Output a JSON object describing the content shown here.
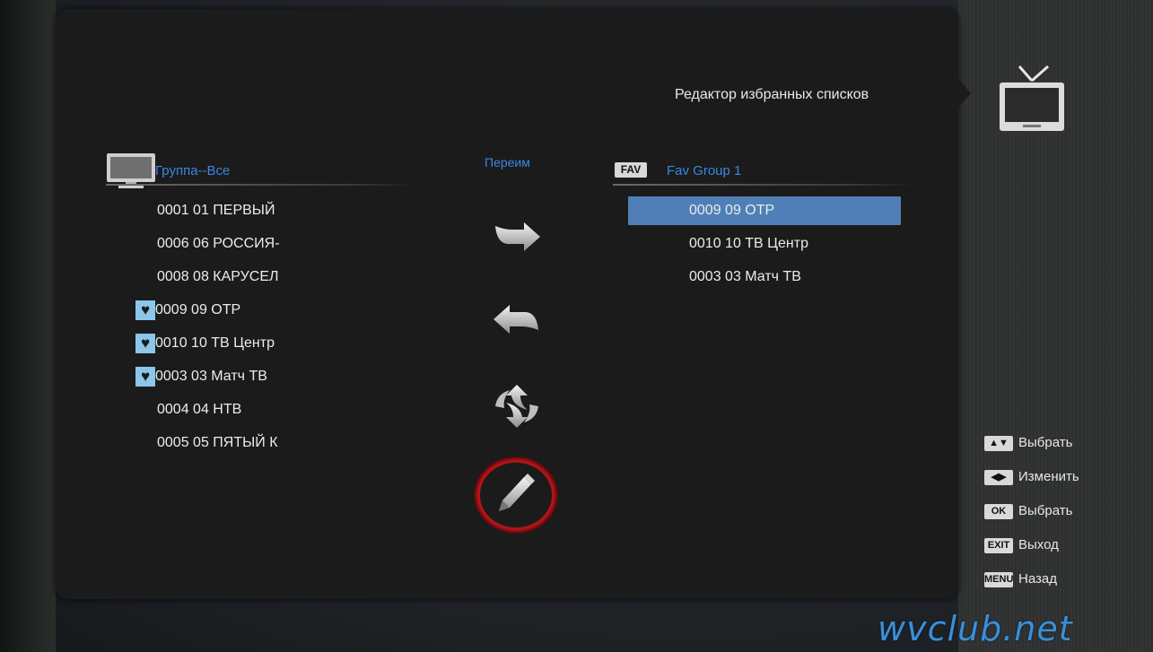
{
  "page_title": "Редактор избранных списков",
  "source_group": {
    "title": "Группа--Все",
    "channels": [
      {
        "label": "0001 01 ПЕРВЫЙ",
        "favorite": false
      },
      {
        "label": "0006 06 РОССИЯ-",
        "favorite": false
      },
      {
        "label": "0008 08 КАРУСЕЛ",
        "favorite": false
      },
      {
        "label": "0009 09 ОТР",
        "favorite": true
      },
      {
        "label": "0010 10 ТВ Центр",
        "favorite": true
      },
      {
        "label": "0003 03 Матч ТВ",
        "favorite": true
      },
      {
        "label": "0004 04 НТВ",
        "favorite": false
      },
      {
        "label": "0005 05 ПЯТЫЙ К",
        "favorite": false
      }
    ]
  },
  "mode_label": "Переим",
  "fav_group": {
    "badge": "FAV",
    "title": "Fav Group 1",
    "selected_index": 0,
    "channels": [
      "0009 09 ОТР",
      "0010 10 ТВ Центр",
      "0003 03 Матч ТВ"
    ]
  },
  "actions": [
    {
      "name": "add-to-favorites",
      "icon": "arrow-right-icon"
    },
    {
      "name": "remove-from-favorites",
      "icon": "arrow-left-icon"
    },
    {
      "name": "swap",
      "icon": "swap-arrows-icon"
    },
    {
      "name": "rename",
      "icon": "pencil-icon",
      "selected": true
    }
  ],
  "hints": [
    {
      "key": "▲▼",
      "label": "Выбрать"
    },
    {
      "key": "◀▶",
      "label": "Изменить"
    },
    {
      "key": "OK",
      "label": "Выбрать"
    },
    {
      "key": "EXIT",
      "label": "Выход"
    },
    {
      "key": "MENU",
      "label": "Назад"
    }
  ],
  "watermark": "wvclub.net",
  "colors": {
    "accent": "#3d86e0",
    "selection": "#4f7fb6",
    "favorite_marker": "#8cc6ea",
    "rename_ring": "#c0141a"
  }
}
